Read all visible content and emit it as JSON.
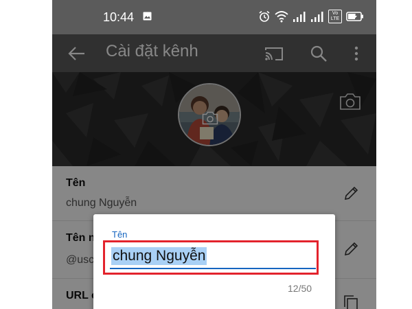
{
  "status_bar": {
    "time": "10:44",
    "icons": [
      "gallery-icon",
      "alarm-icon",
      "wifi-icon",
      "signal-icon",
      "signal-icon",
      "volte-icon",
      "battery-charging-icon"
    ],
    "volte_text": "Vo LTE"
  },
  "app_bar": {
    "title": "Cài đặt kênh",
    "icons": [
      "back-arrow-icon",
      "cast-icon",
      "search-icon",
      "more-vert-icon"
    ]
  },
  "banner": {
    "icons": [
      "camera-icon"
    ]
  },
  "settings": {
    "name": {
      "title": "Tên",
      "value": "chung Nguyễn"
    },
    "handle": {
      "title": "Tên n",
      "value": "@usc"
    },
    "url": {
      "title": "URL c"
    }
  },
  "dialog": {
    "label": "Tên",
    "input_value": "chung Nguyễn",
    "counter": "12/50"
  },
  "colors": {
    "app_bar": "#5b5b5b",
    "accent": "#1565c0",
    "highlight": "#e3232c",
    "selection": "#a9d0f5"
  }
}
